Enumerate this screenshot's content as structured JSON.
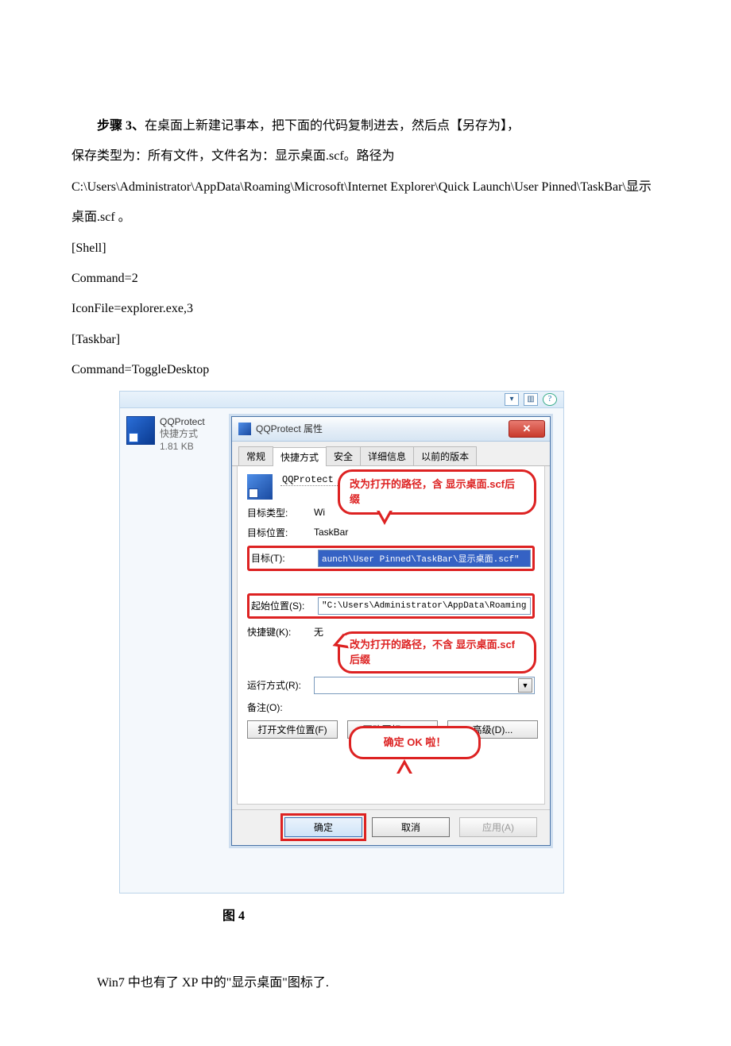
{
  "doc": {
    "step_label": "步骤 3、",
    "step_text": "在桌面上新建记事本，把下面的代码复制进去，然后点【另存为】，",
    "line2": "保存类型为：所有文件，文件名为：显示桌面.scf。路径为",
    "line3": "C:\\Users\\Administrator\\AppData\\Roaming\\Microsoft\\Internet Explorer\\Quick Launch\\User Pinned\\TaskBar\\显示桌面.scf  。",
    "code": [
      "[Shell]",
      "Command=2",
      "IconFile=explorer.exe,3",
      "[Taskbar]",
      "Command=ToggleDesktop"
    ],
    "figure_label": "图 4",
    "final": "Win7 中也有了 XP 中的\"显示桌面\"图标了."
  },
  "explorer": {
    "file": {
      "name": "QQProtect",
      "type": "快捷方式",
      "size": "1.81 KB"
    },
    "toolbar_icons": [
      "view",
      "layout",
      "help"
    ]
  },
  "dialog": {
    "title": "QQProtect 属性",
    "tabs": [
      "常规",
      "快捷方式",
      "安全",
      "详细信息",
      "以前的版本"
    ],
    "active_tab": 1,
    "shortcut_name": "QQProtect",
    "rows": {
      "target_type_lbl": "目标类型:",
      "target_type_val": "Wi",
      "target_loc_lbl": "目标位置:",
      "target_loc_val": "TaskBar",
      "target_lbl": "目标(T):",
      "target_val": "aunch\\User Pinned\\TaskBar\\显示桌面.scf\"",
      "startin_lbl": "起始位置(S):",
      "startin_val": "\"C:\\Users\\Administrator\\AppData\\Roaming",
      "hotkey_lbl": "快捷键(K):",
      "hotkey_val": "无",
      "run_lbl": "运行方式(R):",
      "comment_lbl": "备注(O):"
    },
    "buttons_row": [
      "打开文件位置(F)",
      "更改图标(C)...",
      "高级(D)..."
    ],
    "footer": {
      "ok": "确定",
      "cancel": "取消",
      "apply": "应用(A)"
    },
    "annot1": "改为打开的路径，含 显示桌面.scf后缀",
    "annot2": "改为打开的路径，不含 显示桌面.scf后缀",
    "annot_ok": "确定 OK 啦！"
  }
}
